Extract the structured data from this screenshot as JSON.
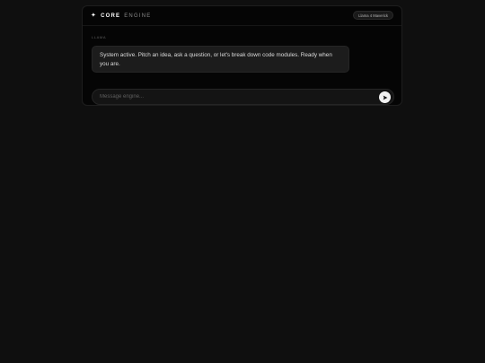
{
  "header": {
    "brand_icon": "✦",
    "brand_strong": "CORE",
    "brand_light": "ENGINE",
    "model_badge": "Llama 4 Maverick"
  },
  "conversation": {
    "sender_label": "LLAMA",
    "message": "System active. Pitch an idea, ask a question, or let's break down code modules. Ready when you are."
  },
  "composer": {
    "placeholder": "Message engine...",
    "value": ""
  },
  "icons": {
    "brand": "sparkle-icon",
    "send": "send-icon"
  },
  "colors": {
    "background": "#0f0f0f",
    "panel": "#050505",
    "bubble": "#1c1c1c",
    "send_button": "#f2f2f2"
  }
}
